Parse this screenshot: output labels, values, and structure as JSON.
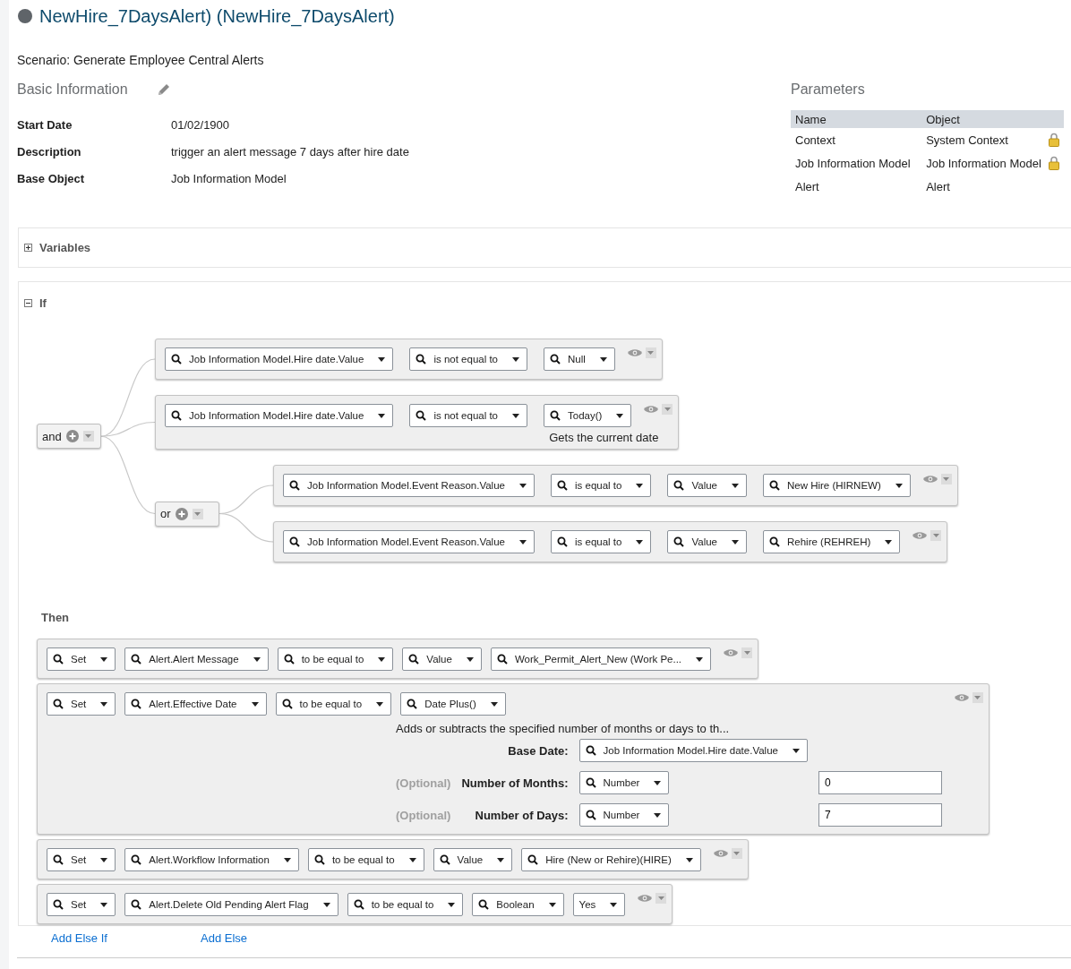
{
  "title": "NewHire_7DaysAlert) (NewHire_7DaysAlert)",
  "scenario": "Scenario: Generate Employee Central Alerts",
  "basic_information": {
    "heading": "Basic Information",
    "fields": [
      {
        "label": "Start Date",
        "value": "01/02/1900"
      },
      {
        "label": "Description",
        "value": "trigger an alert message 7 days after hire date"
      },
      {
        "label": "Base Object",
        "value": "Job Information Model"
      }
    ]
  },
  "parameters": {
    "heading": "Parameters",
    "columns": [
      "Name",
      "Object"
    ],
    "rows": [
      {
        "name": "Context",
        "object": "System Context",
        "locked": true
      },
      {
        "name": "Job Information Model",
        "object": "Job Information Model",
        "locked": true
      },
      {
        "name": "Alert",
        "object": "Alert",
        "locked": false
      }
    ]
  },
  "variables": {
    "label": "Variables",
    "expanded": false
  },
  "if_block": {
    "label": "If",
    "expanded": true,
    "condition": {
      "kind": "group",
      "operator": "and",
      "children": [
        {
          "kind": "condition",
          "fields": [
            {
              "text": "Job Information Model.Hire date.Value",
              "search": true
            },
            {
              "text": "is not equal to",
              "search": true
            },
            {
              "text": "Null",
              "search": true
            }
          ]
        },
        {
          "kind": "condition",
          "fields": [
            {
              "text": "Job Information Model.Hire date.Value",
              "search": true
            },
            {
              "text": "is not equal to",
              "search": true
            },
            {
              "text": "Today()",
              "search": true
            }
          ],
          "hint": "Gets the current date"
        },
        {
          "kind": "group",
          "operator": "or",
          "children": [
            {
              "kind": "condition",
              "fields": [
                {
                  "text": "Job Information Model.Event Reason.Value",
                  "search": true
                },
                {
                  "text": "is equal to",
                  "search": true
                },
                {
                  "text": "Value",
                  "search": true
                },
                {
                  "text": "New Hire (HIRNEW)",
                  "search": true
                }
              ]
            },
            {
              "kind": "condition",
              "fields": [
                {
                  "text": "Job Information Model.Event Reason.Value",
                  "search": true
                },
                {
                  "text": "is equal to",
                  "search": true
                },
                {
                  "text": "Value",
                  "search": true
                },
                {
                  "text": "Rehire (REHREH)",
                  "search": true
                }
              ]
            }
          ]
        }
      ]
    }
  },
  "then_block": {
    "label": "Then",
    "actions": [
      {
        "fields": [
          {
            "text": "Set",
            "search": true
          },
          {
            "text": "Alert.Alert Message",
            "search": true
          },
          {
            "text": "to be equal to",
            "search": true
          },
          {
            "text": "Value",
            "search": true
          },
          {
            "text": "Work_Permit_Alert_New (Work Pe...",
            "search": true
          }
        ]
      },
      {
        "fields": [
          {
            "text": "Set",
            "search": true
          },
          {
            "text": "Alert.Effective Date",
            "search": true
          },
          {
            "text": "to be equal to",
            "search": true
          },
          {
            "text": "Date Plus()",
            "search": true
          }
        ],
        "function": {
          "description": "Adds or subtracts the specified number of months or days to th...",
          "params": [
            {
              "label": "Base Date:",
              "field": {
                "text": "Job Information Model.Hire date.Value",
                "search": true
              }
            },
            {
              "optional": "(Optional)",
              "label": "Number of Months:",
              "field": {
                "text": "Number",
                "search": true
              },
              "value": "0"
            },
            {
              "optional": "(Optional)",
              "label": "Number of Days:",
              "field": {
                "text": "Number",
                "search": true
              },
              "value": "7"
            }
          ]
        }
      },
      {
        "fields": [
          {
            "text": "Set",
            "search": true
          },
          {
            "text": "Alert.Workflow Information",
            "search": true
          },
          {
            "text": "to be equal to",
            "search": true
          },
          {
            "text": "Value",
            "search": true
          },
          {
            "text": "Hire (New or Rehire)(HIRE)",
            "search": true
          }
        ]
      },
      {
        "fields": [
          {
            "text": "Set",
            "search": true
          },
          {
            "text": "Alert.Delete Old Pending Alert Flag",
            "search": true
          },
          {
            "text": "to be equal to",
            "search": true
          },
          {
            "text": "Boolean",
            "search": true
          },
          {
            "text": "Yes",
            "search": false
          }
        ]
      }
    ]
  },
  "links": [
    "Add Else If",
    "Add Else"
  ]
}
